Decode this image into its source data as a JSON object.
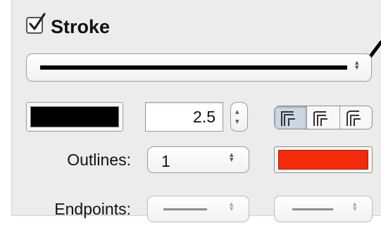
{
  "stroke": {
    "enabled": true,
    "title": "Stroke"
  },
  "width": {
    "value": "2.5"
  },
  "outlines": {
    "label": "Outlines:",
    "value": "1"
  },
  "endpoints": {
    "label": "Endpoints:"
  },
  "colors": {
    "stroke_color": "#000000",
    "outline_color": "#f52a0a",
    "panel_bg": "#ececec",
    "selected_segment": "#cdd6e4"
  },
  "icons": {
    "checkmark": "checkmark-icon",
    "popup_arrows": "up-down-arrows-icon",
    "stepper": "stepper-arrows-icon",
    "stroke_position": [
      "stroke-inside-icon",
      "stroke-center-icon",
      "stroke-outside-icon"
    ]
  },
  "stroke_position": {
    "selected_index": 0
  }
}
